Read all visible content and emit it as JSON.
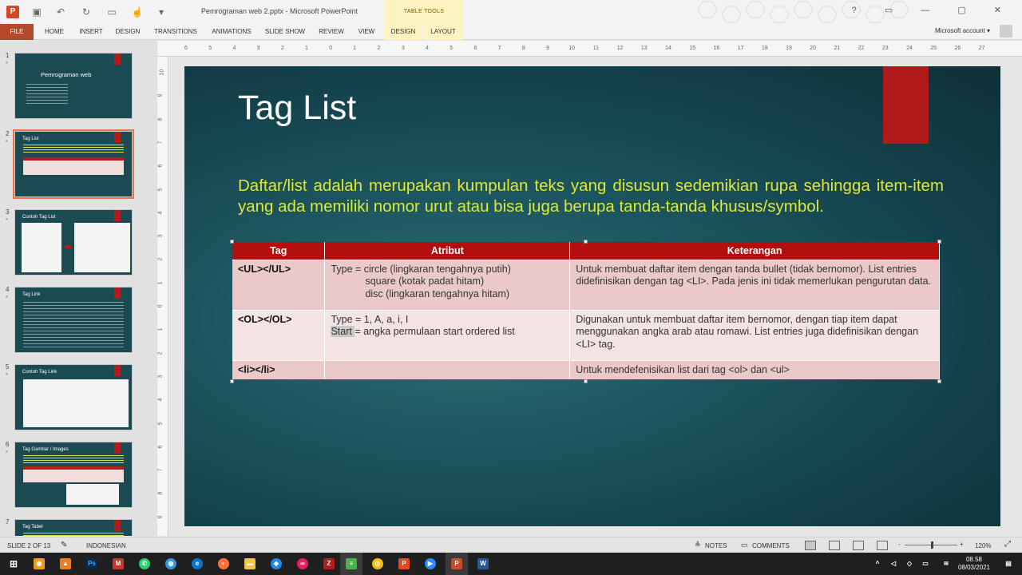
{
  "app": {
    "document_title": "Pemrograman web 2.pptx - Microsoft PowerPoint",
    "context_tab_group": "TABLE TOOLS",
    "account": "Microsoft account",
    "account_arrow": "▾"
  },
  "ribbon": {
    "file": "FILE",
    "tabs": [
      "HOME",
      "INSERT",
      "DESIGN",
      "TRANSITIONS",
      "ANIMATIONS",
      "SLIDE SHOW",
      "REVIEW",
      "VIEW"
    ],
    "context_tabs": [
      "DESIGN",
      "LAYOUT"
    ]
  },
  "thumbnails": [
    {
      "number": "1",
      "title": "Pemrograman web"
    },
    {
      "number": "2",
      "title": "Tag List",
      "selected": true
    },
    {
      "number": "3",
      "title": "Contoh Tag List"
    },
    {
      "number": "4",
      "title": "Tag Link"
    },
    {
      "number": "5",
      "title": "Contoh Tag Link"
    },
    {
      "number": "6",
      "title": "Tag Gambar / Images"
    },
    {
      "number": "7",
      "title": "Tag Tabel"
    }
  ],
  "ruler": {
    "horizontal": [
      "6",
      "5",
      "4",
      "3",
      "2",
      "1",
      "0",
      "1",
      "2",
      "3",
      "4",
      "5",
      "6",
      "7",
      "8",
      "9",
      "10",
      "11",
      "12",
      "13",
      "14",
      "15",
      "16",
      "17",
      "18",
      "19",
      "20",
      "21",
      "22",
      "23",
      "24",
      "25",
      "26",
      "27"
    ],
    "vertical": [
      "10",
      "9",
      "8",
      "7",
      "6",
      "5",
      "4",
      "3",
      "2",
      "1",
      "0",
      "1",
      "2",
      "3",
      "4",
      "5",
      "6",
      "7",
      "8",
      "9",
      "10"
    ]
  },
  "slide": {
    "title": "Tag List",
    "body": "Daftar/list adalah merupakan kumpulan teks yang disusun sedemikian rupa sehingga item-item yang ada memiliki nomor urut atau bisa juga berupa tanda-tanda khusus/symbol.",
    "table": {
      "headers": [
        "Tag",
        "Atribut",
        "Keterangan"
      ],
      "rows": [
        {
          "tag": "<UL></UL>",
          "attr_lines": [
            "Type = circle (lingkaran tengahnya putih)",
            "square (kotak padat hitam)",
            "disc (lingkaran tengahnya hitam)"
          ],
          "desc": "Untuk membuat daftar item dengan tanda bullet (tidak bernomor). List entries didefinisikan dengan tag <LI>.  Pada jenis ini tidak memerlukan pengurutan data."
        },
        {
          "tag": "<OL></OL>",
          "attr_lines": [
            "Type = 1, A, a, i, I",
            "Start ",
            "= angka permulaan start ordered list"
          ],
          "desc": "Digunakan untuk membuat daftar item bernomor, dengan tiap item dapat menggunakan angka arab atau romawi. List entries juga didefinisikan dengan <LI> tag."
        },
        {
          "tag": "<li></li>",
          "attr_lines": [
            ""
          ],
          "desc": "Untuk mendefenisikan list dari tag <ol> dan <ul>"
        }
      ]
    }
  },
  "status": {
    "slide_counter": "SLIDE 2 OF 13",
    "language": "INDONESIAN",
    "notes": "NOTES",
    "comments": "COMMENTS",
    "zoom_minus": "-",
    "zoom_plus": "+",
    "zoom": "120%",
    "zoom_level_percent": 120
  },
  "taskbar": {
    "time": "08.58",
    "date": "08/03/2021"
  }
}
